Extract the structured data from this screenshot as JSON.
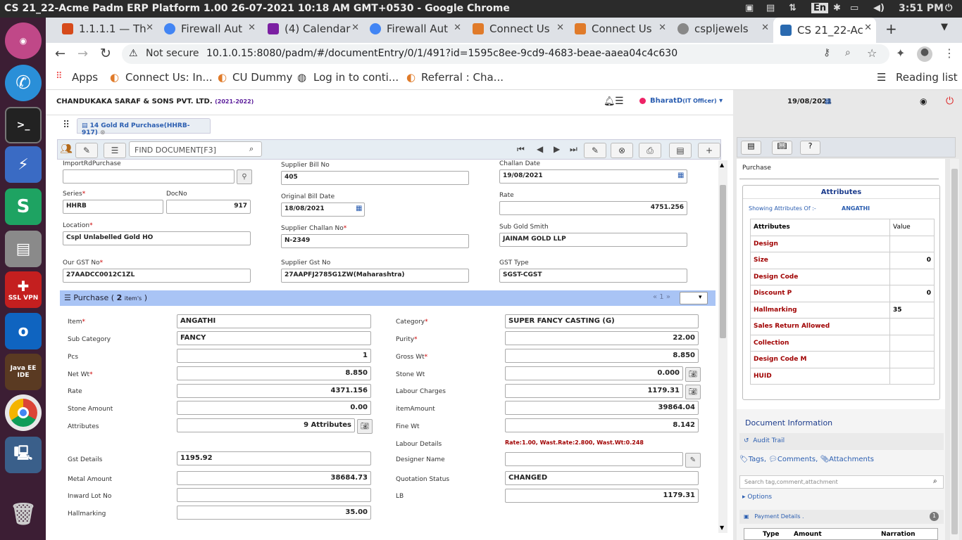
{
  "os": {
    "window_title": "CS 21_22-Acme Padm ERP Platform 1.00 26-07-2021 10:18 AM GMT+0530 - Google Chrome",
    "clock": "3:51 PM",
    "keyboard": "En"
  },
  "launcher": [
    "ubuntu-icon",
    "phone-icon",
    "terminal-icon",
    "remote-desktop-icon",
    "spreadsheet-icon",
    "file-cabinet-icon",
    "ssl-vpn-icon",
    "outlook-icon",
    "java-ide-icon",
    "chrome-icon",
    "network-icon",
    "trash-icon"
  ],
  "launcher_text": {
    "ssl": "SSL VPN",
    "outlook": "o",
    "java": "Java EE IDE"
  },
  "tabs": [
    {
      "label": "1.1.1.1 — Th",
      "color": "#d64a1a"
    },
    {
      "label": "Firewall Aut",
      "color": "#4285f4"
    },
    {
      "label": "(4) Calendar",
      "color": "#7b1fa2"
    },
    {
      "label": "Firewall Aut",
      "color": "#4285f4"
    },
    {
      "label": "Connect Us",
      "color": "#e07b2a"
    },
    {
      "label": "Connect Us",
      "color": "#e07b2a"
    },
    {
      "label": "cspljewels",
      "color": "#888888"
    },
    {
      "label": "CS 21_22-Ac",
      "color": "#2a6ab0"
    }
  ],
  "browser": {
    "not_secure": "Not secure",
    "url": "10.1.0.15:8080/padm/#/documentEntry/0/1/491?id=1595c8ee-9cd9-4683-beae-aaea04c4c630",
    "apps": "Apps",
    "reading_list": "Reading list"
  },
  "bookmarks": [
    "Connect Us: In...",
    "CU Dummy",
    "Log in to conti...",
    "Referral : Cha..."
  ],
  "header": {
    "company": "CHANDUKAKA SARAF & SONS PVT. LTD.",
    "year": "(2021-2022)",
    "user": "BharatD",
    "role": "(IT Officer)",
    "date": "19/08/2021"
  },
  "doc_tab": "14 Gold Rd Purchase(HHRB-917)",
  "find_placeholder": "FIND DOCUMENT[F3]",
  "form": {
    "import_label": "ImportRdPurchase",
    "import_value": "",
    "supplier_bill_label": "Supplier Bill No",
    "supplier_bill": "405",
    "challan_date_label": "Challan Date",
    "challan_date": "19/08/2021",
    "series_label": "Series",
    "series": "HHRB",
    "docno_label": "DocNo",
    "docno": "917",
    "orig_bill_date_label": "Original Bill Date",
    "orig_bill_date": "18/08/2021",
    "rate_label": "Rate",
    "rate": "4751.256",
    "location_label": "Location",
    "location": "Cspl Unlabelled Gold HO",
    "supplier_challan_label": "Supplier Challan No",
    "supplier_challan": "N-2349",
    "sub_gold_smith_label": "Sub Gold Smith",
    "sub_gold_smith": "JAINAM GOLD LLP",
    "our_gst_label": "Our GST No",
    "our_gst": "27AADCC0012C1ZL",
    "supplier_gst_label": "Supplier Gst No",
    "supplier_gst": "27AAPFJ2785G1ZW(Maharashtra)",
    "gst_type_label": "GST Type",
    "gst_type": "SGST-CGST"
  },
  "purchase": {
    "title": "Purchase (",
    "count": "2",
    "items": "item's",
    "close": ")",
    "pager": "«  1  »"
  },
  "item": {
    "item_label": "Item",
    "item": "ANGATHI",
    "category_label": "Category",
    "category": "SUPER FANCY CASTING (G)",
    "subcat_label": "Sub Category",
    "subcat": "FANCY",
    "purity_label": "Purity",
    "purity": "22.00",
    "pcs_label": "Pcs",
    "pcs": "1",
    "gross_label": "Gross Wt",
    "gross": "8.850",
    "net_label": "Net Wt",
    "net": "8.850",
    "stone_wt_label": "Stone Wt",
    "stone_wt": "0.000",
    "rate_label": "Rate",
    "rate": "4371.156",
    "labour_label": "Labour Charges",
    "labour": "1179.31",
    "stone_amt_label": "Stone Amount",
    "stone_amt": "0.00",
    "item_amt_label": "itemAmount",
    "item_amt": "39864.04",
    "attributes_label": "Attributes",
    "attributes": "9 Attributes",
    "fine_label": "Fine Wt",
    "fine": "8.142",
    "labour_details_label": "Labour Details",
    "labour_details": "Rate:1.00, Wast.Rate:2.800, Wast.Wt:0.248",
    "gst_label": "Gst Details",
    "gst": "1195.92",
    "designer_label": "Designer Name",
    "designer": "",
    "metal_label": "Metal Amount",
    "metal": "38684.73",
    "quotation_label": "Quotation Status",
    "quotation": "CHANGED",
    "inward_label": "Inward Lot No",
    "inward": "",
    "lb_label": "LB",
    "lb": "1179.31",
    "hallmarking_label": "Hallmarking",
    "hallmarking": "35.00"
  },
  "right_panel": {
    "section": "Purchase",
    "attr_title": "Attributes",
    "showing": "Showing Attributes Of :-",
    "showing_of": "ANGATHI",
    "col_attr": "Attributes",
    "col_value": "Value",
    "rows": [
      [
        "Design",
        ""
      ],
      [
        "Size",
        "0"
      ],
      [
        "Design Code",
        ""
      ],
      [
        "Discount P",
        "0"
      ],
      [
        "Hallmarking",
        "35"
      ],
      [
        "Sales Return Allowed",
        ""
      ],
      [
        "Collection",
        ""
      ],
      [
        "Design Code M",
        ""
      ],
      [
        "HUID",
        ""
      ]
    ],
    "doc_info": "Document Information",
    "audit": "Audit Trail",
    "tags": "Tags,",
    "comments": "Comments,",
    "attachments": "Attachments",
    "search_placeholder": "Search tag,comment,attachment",
    "options": "Options",
    "payment": "Payment Details .",
    "payment_count": "1",
    "pay_cols": [
      "Type",
      "Amount",
      "Narration"
    ]
  },
  "colors": {
    "section_bar": "#a9c4f5",
    "label_red": "#a00000",
    "link": "#2a5db0",
    "toolbar_bg": "#e6edf3"
  }
}
